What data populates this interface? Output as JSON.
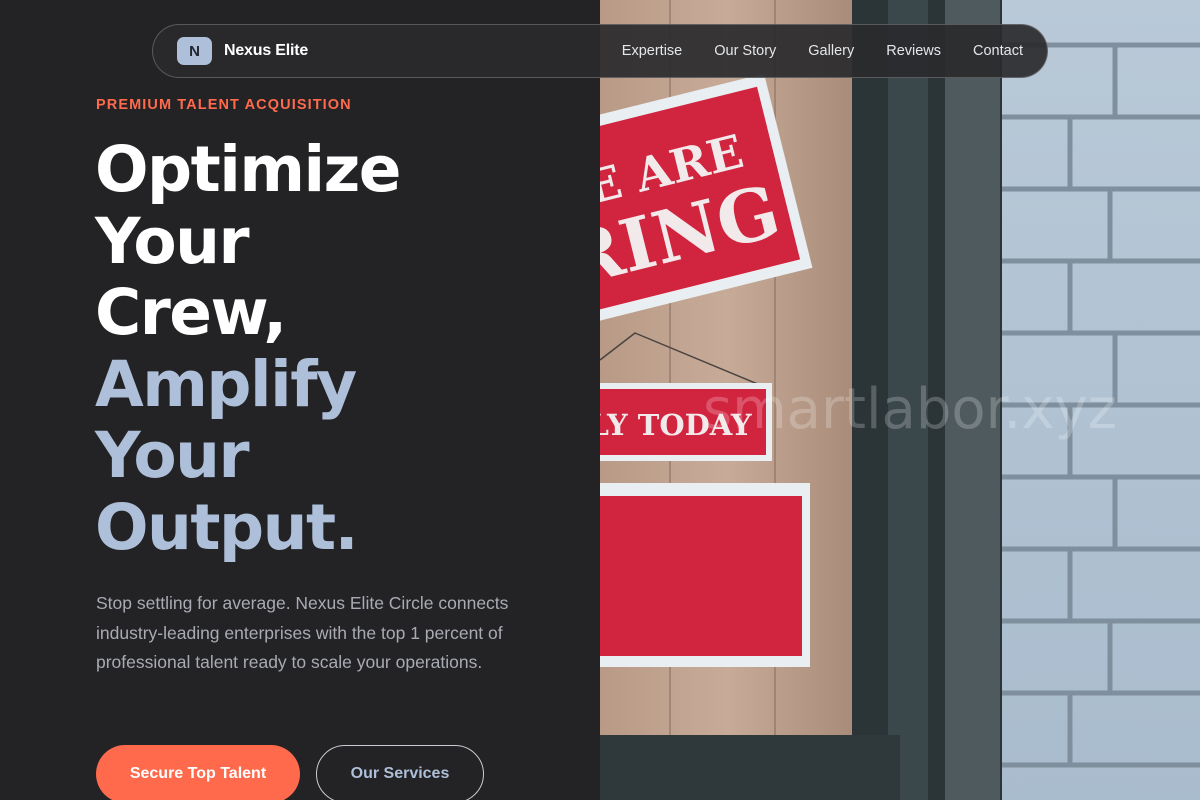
{
  "nav": {
    "logo_letter": "N",
    "brand": "Nexus Elite",
    "links": [
      "Expertise",
      "Our Story",
      "Gallery",
      "Reviews",
      "Contact"
    ]
  },
  "hero": {
    "eyebrow": "PREMIUM TALENT ACQUISITION",
    "headline_lines_white": [
      "Optimize",
      "Your",
      "Crew,"
    ],
    "headline_lines_accent": [
      "Amplify",
      "Your",
      "Output."
    ],
    "lede": "Stop settling for average. Nexus Elite Circle connects industry-leading enterprises with the top 1 percent of professional talent ready to scale your operations.",
    "primary_cta": "Secure Top Talent",
    "secondary_cta": "Our Services"
  },
  "photo": {
    "sign_top": "E ARE",
    "sign_top_2": "RING",
    "sign_mid": "LY TODAY",
    "watermark": "smartlabor.xyz"
  },
  "colors": {
    "background": "#232325",
    "accent_orange": "#ff6a4d",
    "accent_blue": "#aebfd9",
    "sign_red": "#d1243f"
  }
}
